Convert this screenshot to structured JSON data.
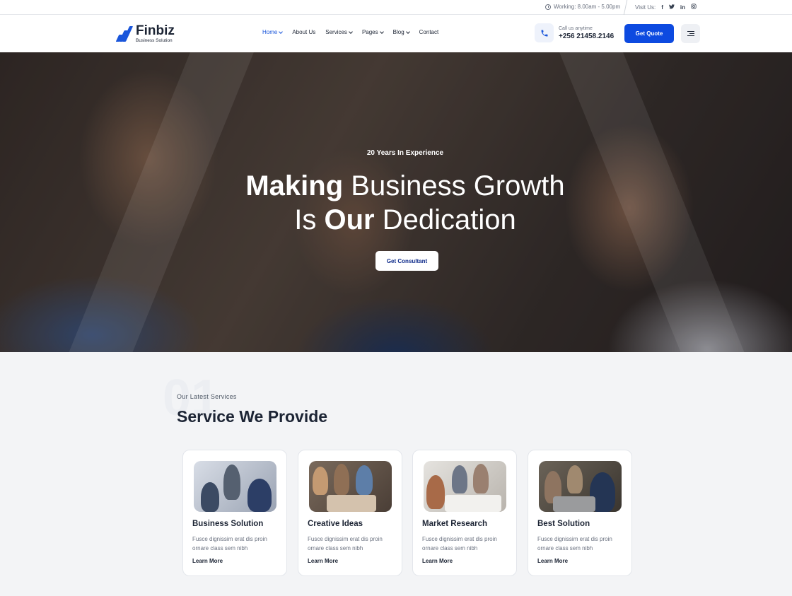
{
  "topbar": {
    "working": "Working: 8.00am - 5.00pm",
    "visit_label": "Visit Us:",
    "socials": [
      "f",
      "t",
      "in",
      "ig"
    ]
  },
  "brand": {
    "name": "Finbiz",
    "tagline": "Business Solution",
    "accent": "#0d4ae0"
  },
  "nav": {
    "items": [
      {
        "label": "Home",
        "dropdown": true,
        "active": true
      },
      {
        "label": "About Us",
        "dropdown": false
      },
      {
        "label": "Services",
        "dropdown": true
      },
      {
        "label": "Pages",
        "dropdown": true
      },
      {
        "label": "Blog",
        "dropdown": true
      },
      {
        "label": "Contact",
        "dropdown": false
      }
    ]
  },
  "call": {
    "label": "Call us anytime",
    "number": "+256 21458.2146",
    "icon": "phone-icon"
  },
  "header_button": "Get Quote",
  "hero": {
    "experience": "20 Years In Experience",
    "line1_bold": "Making",
    "line1_rest": " Business Growth",
    "line2_pre": "Is ",
    "line2_bold": "Our",
    "line2_rest": " Dedication",
    "button": "Get Consultant"
  },
  "services": {
    "number": "01",
    "subtitle": "Our Latest Services",
    "title": "Service We Provide",
    "cards": [
      {
        "title": "Business Solution",
        "desc": "Fusce dignissim erat dis proin ornare class sem nibh",
        "link": "Learn More"
      },
      {
        "title": "Creative Ideas",
        "desc": "Fusce dignissim erat dis proin ornare class sem nibh",
        "link": "Learn More"
      },
      {
        "title": "Market Research",
        "desc": "Fusce dignissim erat dis proin ornare class sem nibh",
        "link": "Learn More"
      },
      {
        "title": "Best Solution",
        "desc": "Fusce dignissim erat dis proin ornare class sem nibh",
        "link": "Learn More"
      }
    ]
  }
}
